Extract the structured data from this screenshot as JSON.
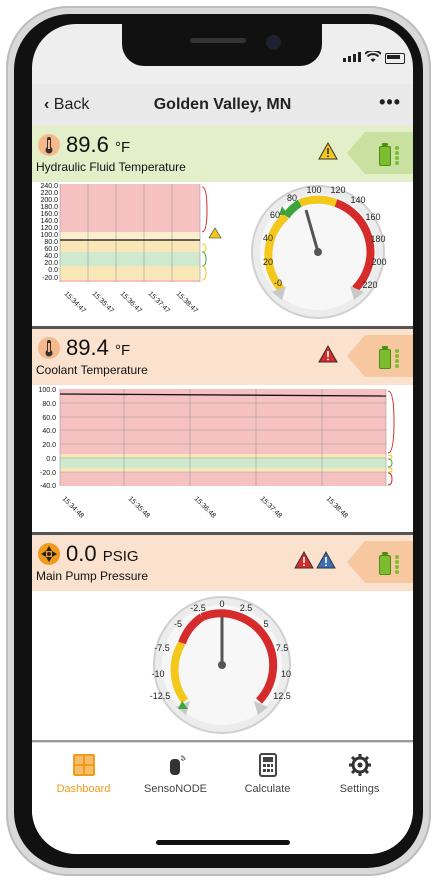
{
  "nav": {
    "back_label": "Back",
    "title": "Golden Valley, MN",
    "more_label": "•••"
  },
  "cards": [
    {
      "value": "89.6",
      "unit": "°F",
      "name": "Hydraulic Fluid Temperature",
      "status_color": "#e2efc8",
      "chart": {
        "y_ticks": [
          "240.0",
          "220.0",
          "200.0",
          "180.0",
          "160.0",
          "140.0",
          "120.0",
          "100.0",
          "80.0",
          "60.0",
          "40.0",
          "20.0",
          "0.0",
          "-20.0"
        ],
        "x_ticks": [
          "15:34:47",
          "15:35:47",
          "15:36:47",
          "15:37:47",
          "15:38:47"
        ]
      },
      "gauge_labels": [
        "-0",
        "20",
        "40",
        "60",
        "80",
        "100",
        "120",
        "140",
        "160",
        "180",
        "200",
        "220"
      ]
    },
    {
      "value": "89.4",
      "unit": "°F",
      "name": "Coolant Temperature",
      "status_color": "#fbe2cf",
      "chart": {
        "y_ticks": [
          "100.0",
          "80.0",
          "60.0",
          "40.0",
          "20.0",
          "0.0",
          "-20.0",
          "-40.0"
        ],
        "x_ticks": [
          "15:34:48",
          "15:35:48",
          "15:36:48",
          "15:37:48",
          "15:38:48"
        ]
      }
    },
    {
      "value": "0.0",
      "unit": "PSIG",
      "name": "Main Pump Pressure",
      "status_color": "#fbe2cf",
      "gauge_labels": [
        "-12.5",
        "-10",
        "-7.5",
        "-5",
        "-2.5",
        "0",
        "2.5",
        "5",
        "7.5",
        "10",
        "12.5"
      ]
    }
  ],
  "tabs": [
    {
      "label": "Dashboard",
      "icon": "dashboard-icon"
    },
    {
      "label": "SensoNODE",
      "icon": "sensor-icon"
    },
    {
      "label": "Calculate",
      "icon": "calculator-icon"
    },
    {
      "label": "Settings",
      "icon": "gear-icon"
    }
  ],
  "colors": {
    "accent": "#f19a1b",
    "ok": "#7cbd2f",
    "alarm": "#d52b2b",
    "warn": "#f3c81b"
  }
}
